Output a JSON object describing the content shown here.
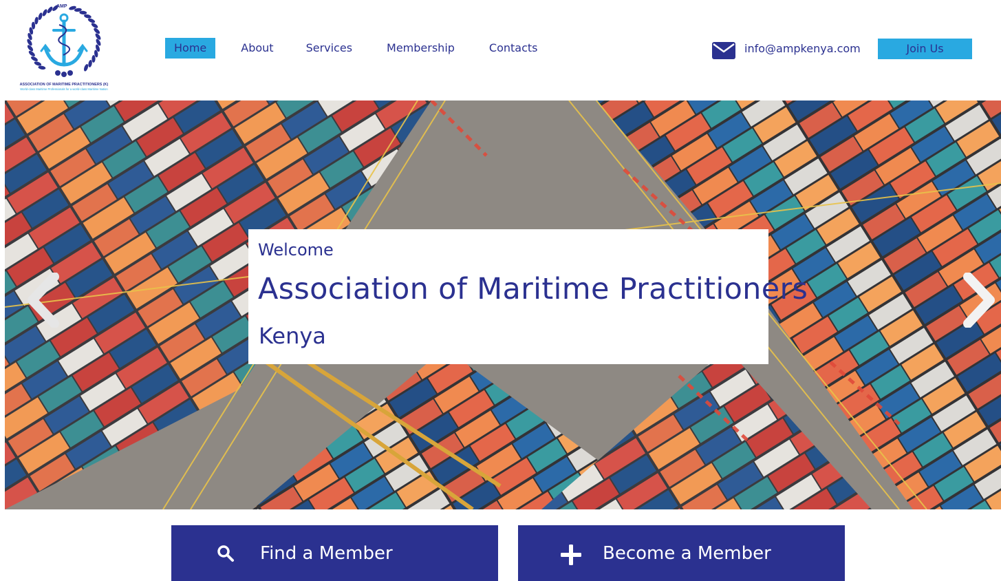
{
  "logo": {
    "amp_text": "AMP",
    "name": "ASSOCIATION OF MARITIME PRACTITIONERS (K)",
    "tagline": "World-class Maritime Professionals for a world-class Maritime Nation",
    "icon": "anchor-wreath-icon",
    "colors": {
      "navy": "#2b3190",
      "cyan": "#29a9e1"
    }
  },
  "nav": {
    "items": [
      {
        "label": "Home",
        "active": true
      },
      {
        "label": "About",
        "active": false
      },
      {
        "label": "Services",
        "active": false
      },
      {
        "label": "Membership",
        "active": false
      },
      {
        "label": "Contacts",
        "active": false
      }
    ]
  },
  "contact": {
    "icon": "envelope-icon",
    "email": "info@ampkenya.com"
  },
  "join_button": {
    "label": "Join Us"
  },
  "hero": {
    "image": "aerial-container-port-photo",
    "welcome": "Welcome",
    "title": "Association of Maritime Practitioners",
    "subtitle": "Kenya",
    "prev_icon": "chevron-left-icon",
    "next_icon": "chevron-right-icon"
  },
  "actions": {
    "find": {
      "label": "Find a Member",
      "icon": "search-icon"
    },
    "become": {
      "label": "Become a Member",
      "icon": "plus-icon"
    }
  },
  "theme": {
    "primary": "#2b3190",
    "accent": "#29a9e1",
    "background": "#ffffff"
  }
}
